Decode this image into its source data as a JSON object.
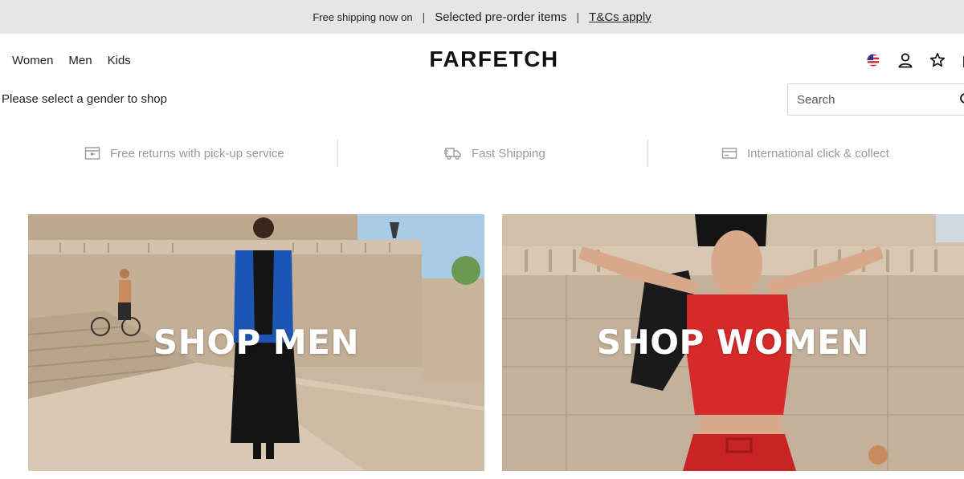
{
  "promo": {
    "part1": "Free shipping now on",
    "separator": "|",
    "part2": "Selected pre-order items",
    "link": "T&Cs apply"
  },
  "nav": {
    "items": [
      {
        "label": "Women"
      },
      {
        "label": "Men"
      },
      {
        "label": "Kids"
      }
    ]
  },
  "brand": {
    "logo": "FARFETCH"
  },
  "header": {
    "icons": [
      "us-flag-icon",
      "account-icon",
      "wishlist-star-icon",
      "bag-icon"
    ]
  },
  "gender_prompt": "Please select a gender to shop",
  "search": {
    "placeholder": "Search",
    "value": ""
  },
  "benefits": [
    {
      "icon": "returns-box-icon",
      "label": "Free returns with pick-up service"
    },
    {
      "icon": "delivery-truck-icon",
      "label": "Fast Shipping"
    },
    {
      "icon": "store-card-icon",
      "label": "International click & collect"
    }
  ],
  "tiles": [
    {
      "label": "SHOP MEN"
    },
    {
      "label": "SHOP WOMEN"
    }
  ],
  "colors": {
    "promo_bg": "#e6e6e6",
    "benefit_text": "#9a9a9a",
    "men_jacket": "#1c55b4",
    "women_outfit": "#d62a2a"
  }
}
